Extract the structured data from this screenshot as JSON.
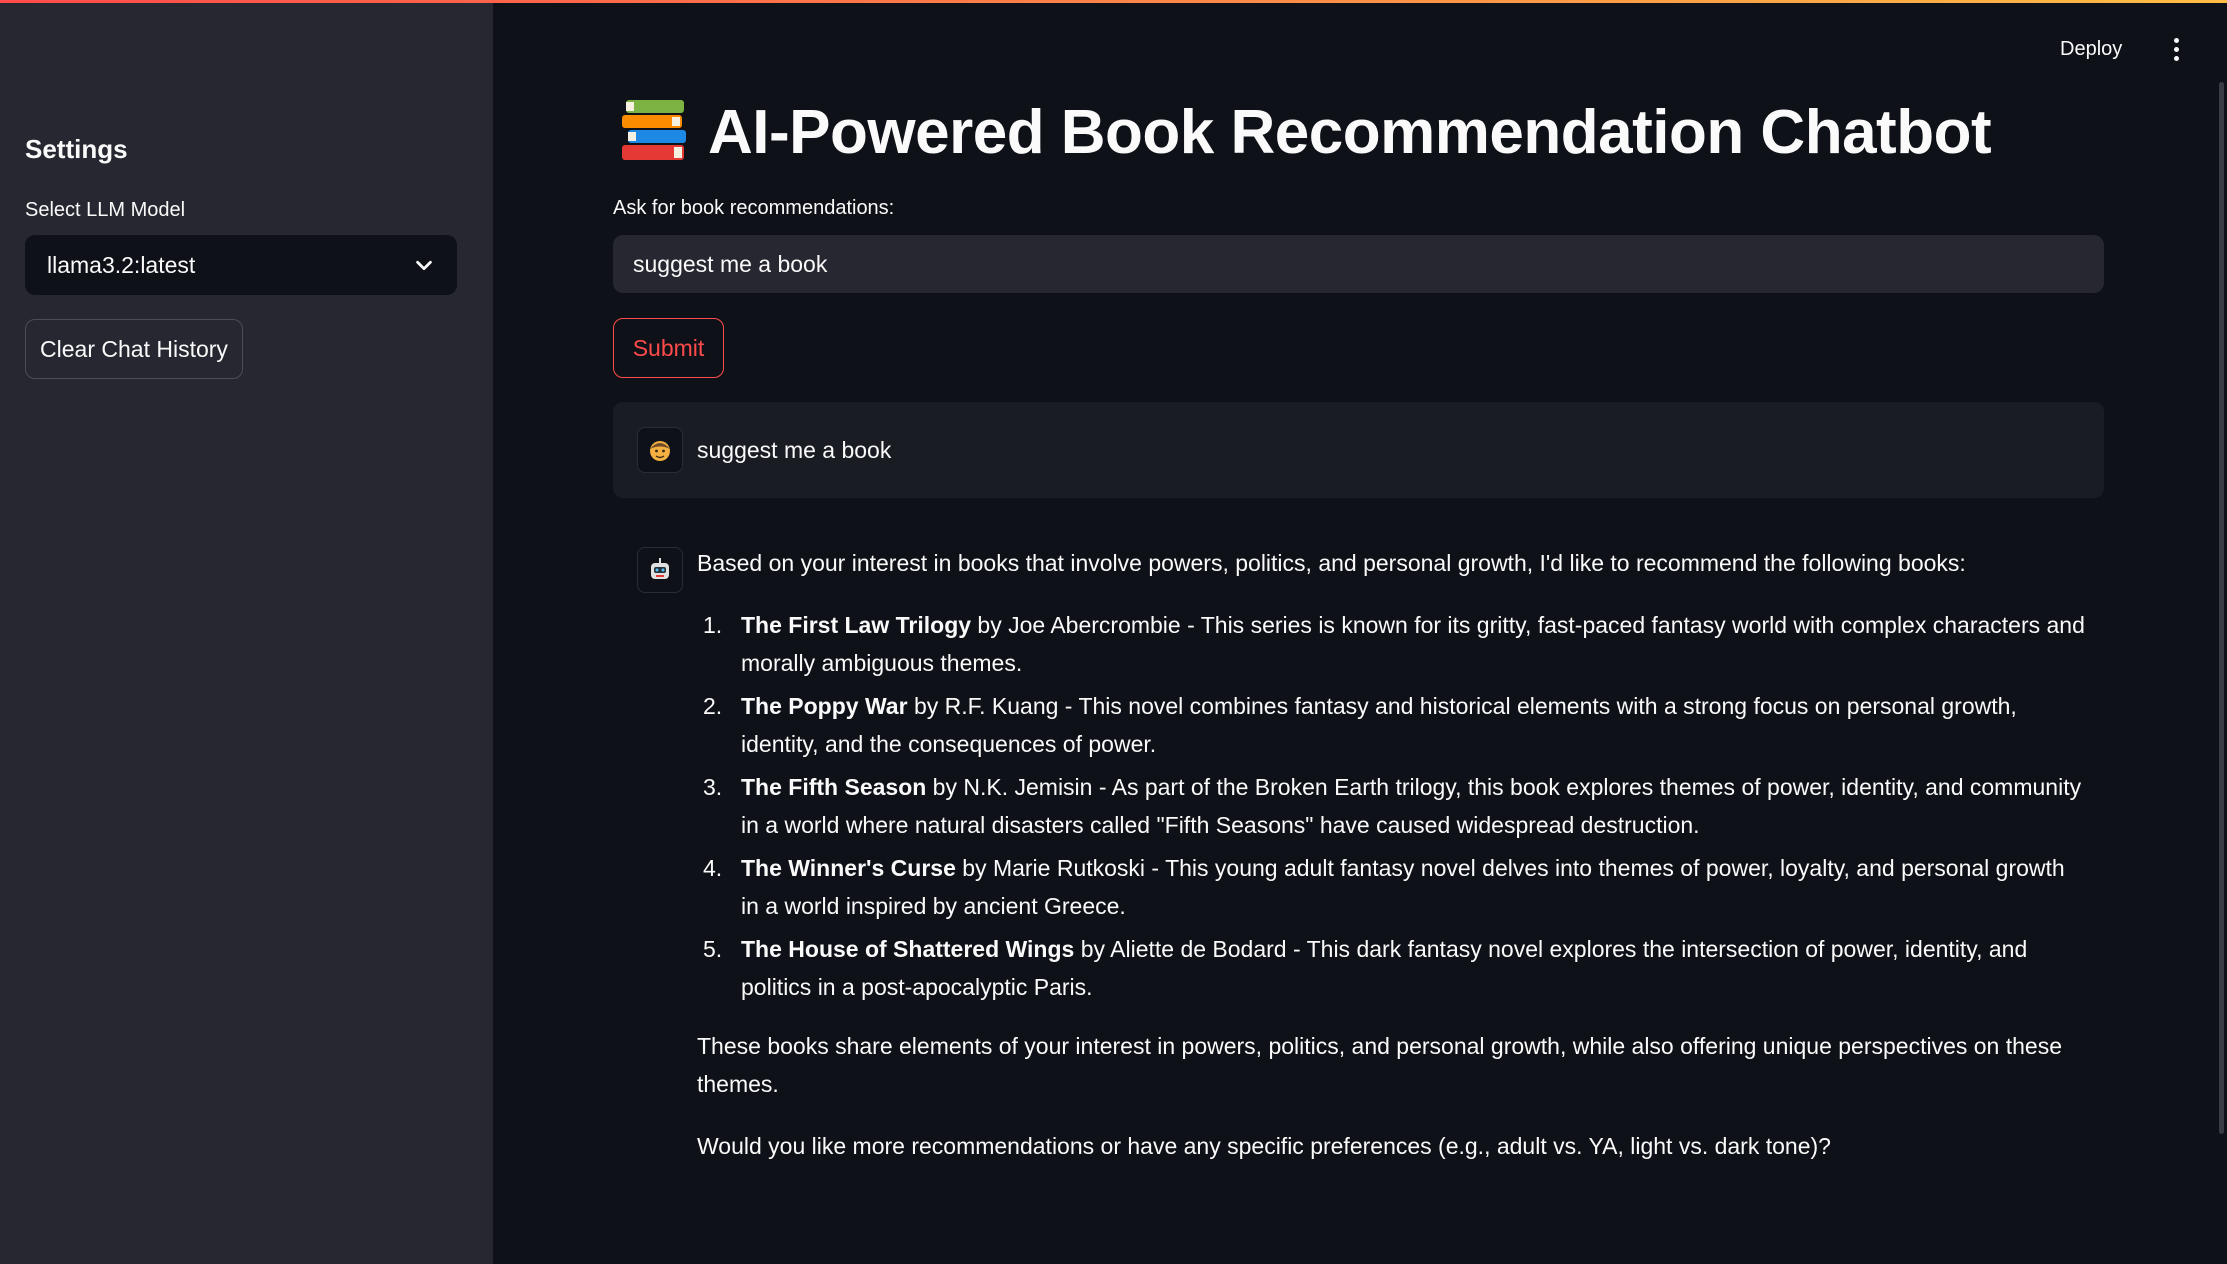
{
  "sidebar": {
    "heading": "Settings",
    "model_label": "Select LLM Model",
    "model_value": "llama3.2:latest",
    "clear_button": "Clear Chat History"
  },
  "header": {
    "deploy": "Deploy",
    "menu_icon": "kebab-menu-icon"
  },
  "main": {
    "title": "AI-Powered Book Recommendation Chatbot",
    "title_icon": "books-icon",
    "input_label": "Ask for book recommendations:",
    "input_value": "suggest me a book",
    "submit": "Submit"
  },
  "chat": {
    "user": {
      "avatar_icon": "user-avatar-icon",
      "text": "suggest me a book"
    },
    "assistant": {
      "avatar_icon": "robot-avatar-icon",
      "intro": "Based on your interest in books that involve powers, politics, and personal growth, I'd like to recommend the following books:",
      "recommendations": [
        {
          "num": "1.",
          "title": "The First Law Trilogy",
          "text": " by Joe Abercrombie - This series is known for its gritty, fast-paced fantasy world with complex characters and morally ambiguous themes."
        },
        {
          "num": "2.",
          "title": "The Poppy War",
          "text": " by R.F. Kuang - This novel combines fantasy and historical elements with a strong focus on personal growth, identity, and the consequences of power."
        },
        {
          "num": "3.",
          "title": "The Fifth Season",
          "text": " by N.K. Jemisin - As part of the Broken Earth trilogy, this book explores themes of power, identity, and community in a world where natural disasters called \"Fifth Seasons\" have caused widespread destruction."
        },
        {
          "num": "4.",
          "title": "The Winner's Curse",
          "text": " by Marie Rutkoski - This young adult fantasy novel delves into themes of power, loyalty, and personal growth in a world inspired by ancient Greece."
        },
        {
          "num": "5.",
          "title": "The House of Shattered Wings",
          "text": " by Aliette de Bodard - This dark fantasy novel explores the intersection of power, identity, and politics in a post-apocalyptic Paris."
        }
      ],
      "outro": "These books share elements of your interest in powers, politics, and personal growth, while also offering unique perspectives on these themes.",
      "question": "Would you like more recommendations or have any specific preferences (e.g., adult vs. YA, light vs. dark tone)?"
    }
  },
  "colors": {
    "background": "#0e1117",
    "sidebar": "#262730",
    "accent": "#ff4b4b",
    "text": "#fafafa"
  }
}
